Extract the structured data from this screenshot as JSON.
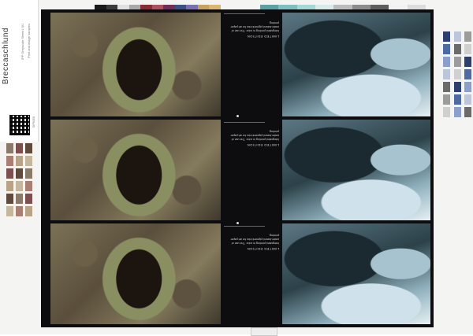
{
  "label": {
    "brand": "Breccaschlund",
    "fine_print_1": "IPP Greyscale Sheet / NU",
    "fine_print_2": "Print and image samples",
    "code": "SIPKEB"
  },
  "panels": {
    "header": "LIMITED EDITION",
    "body": "Integrated printing in color. The use of water-based pigment inks for art paper printing.",
    "rows": [
      {
        "left_image": "tree-stump-photo",
        "right_image": "glacier-photo"
      },
      {
        "left_image": "tree-stump-photo",
        "right_image": "glacier-photo"
      },
      {
        "left_image": "tree-stump-photo",
        "right_image": "glacier-photo"
      }
    ]
  },
  "colors": {
    "top_bar": [
      "#1a1a1a",
      "#3b3b3b",
      "#e0e0e0",
      "#a9a9a9",
      "#8a2c38",
      "#b04e62",
      "#6f2f57",
      "#3a4f86",
      "#7a6fb0",
      "#c7a25a",
      "#d8b873"
    ],
    "top_bar_2": [
      "#5aa2a6",
      "#7fbfc2",
      "#a5d8d8",
      "#d8eaea",
      "#bcbcbc",
      "#8c8c8c",
      "#5e5e5e",
      "#f2f2f2",
      "#dcdcdc"
    ],
    "left_swatches": [
      "#8a7a6a",
      "#a87f72",
      "#7d5050",
      "#b7a386",
      "#5f4a3e",
      "#c4b79d"
    ],
    "right_swatches": [
      "#2d3f6e",
      "#4e6aa2",
      "#8aa0c8",
      "#bcc6da",
      "#6b6b6b",
      "#9c9c9c",
      "#d0d0d0"
    ]
  }
}
